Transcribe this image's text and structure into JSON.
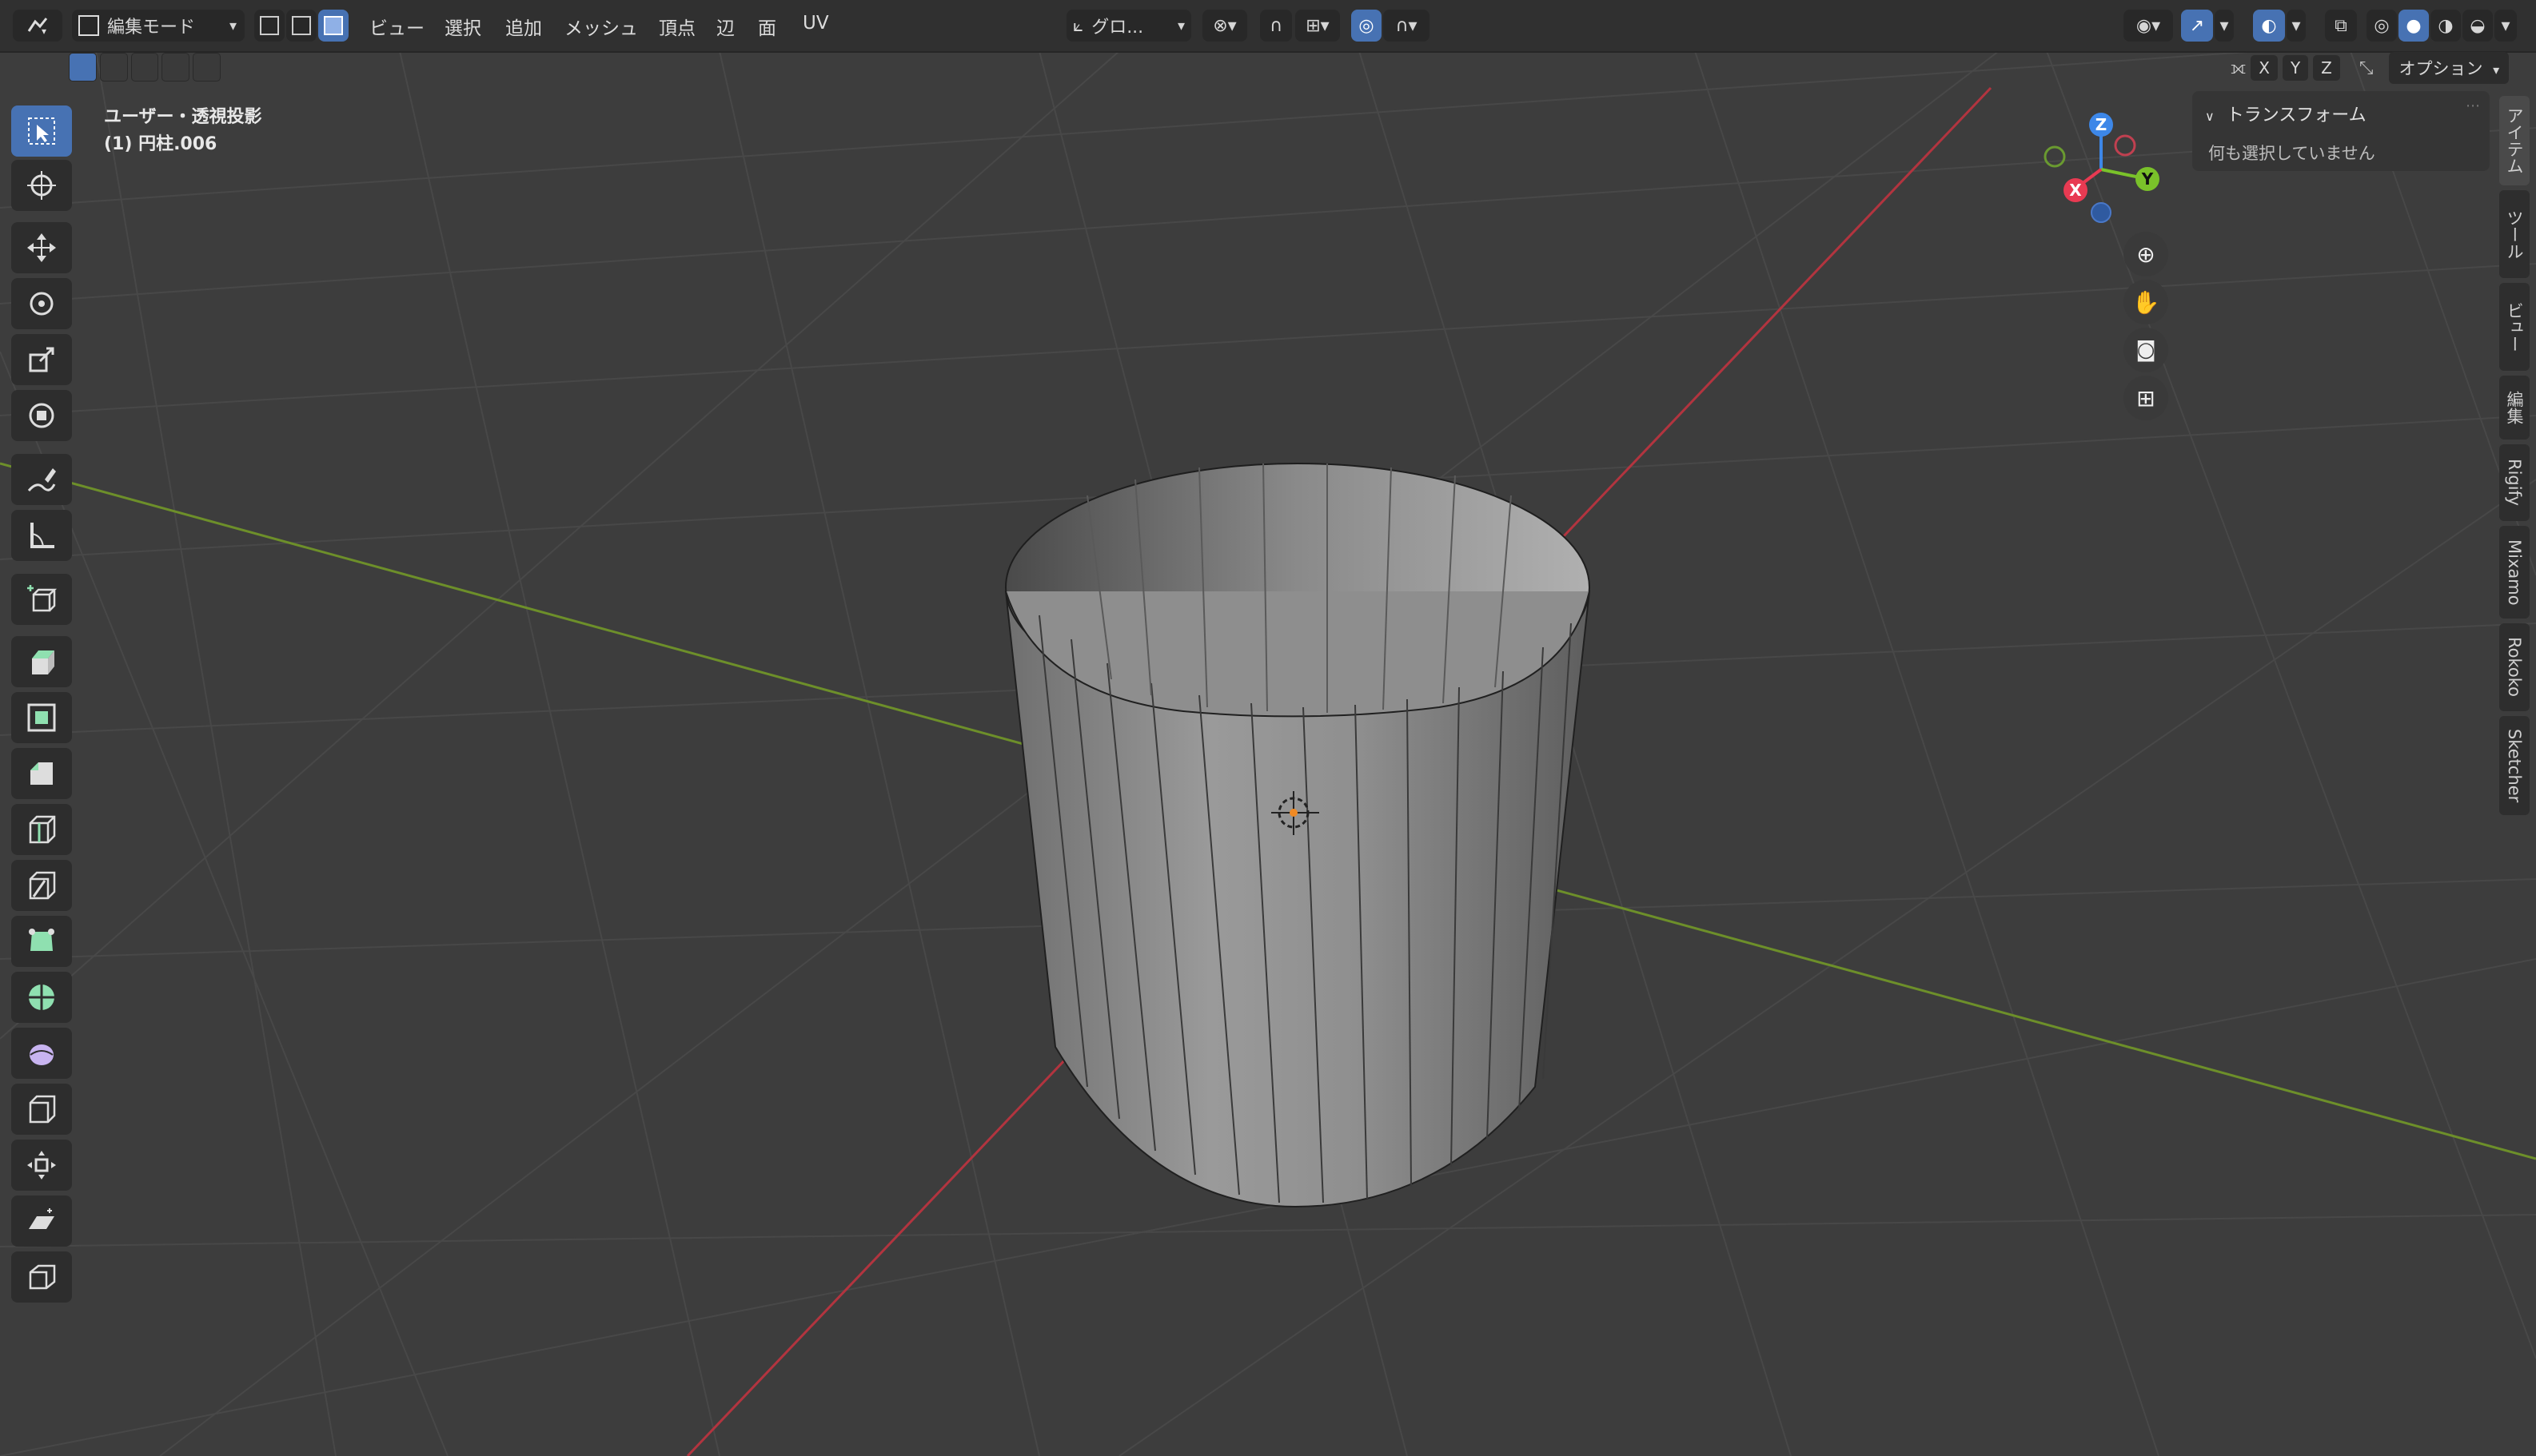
{
  "header": {
    "mode_label": "編集モード",
    "menus": [
      "ビュー",
      "選択",
      "追加",
      "メッシュ",
      "頂点",
      "辺",
      "面",
      "UV"
    ],
    "orientation_label": "グロ...",
    "axis_buttons": [
      "X",
      "Y",
      "Z"
    ],
    "options_label": "オプション"
  },
  "viewport": {
    "view_name": "ユーザー・透視投影",
    "object_name": "(1) 円柱.006"
  },
  "gizmo": {
    "z": "Z",
    "y": "Y",
    "x": "X"
  },
  "npanel": {
    "section_title": "トランスフォーム",
    "empty_message": "何も選択していません",
    "tabs": [
      "アイテム",
      "ツール",
      "ビュー",
      "編集",
      "Rigify",
      "Mixamo",
      "Rokoko",
      "Sketcher"
    ]
  },
  "tools": [
    "select-box-icon",
    "cursor-icon",
    "move-icon",
    "rotate-icon",
    "scale-icon",
    "transform-icon",
    "annotate-icon",
    "measure-icon",
    "add-cube-icon",
    "extrude-icon",
    "inset-icon",
    "bevel-icon",
    "loop-cut-icon",
    "knife-icon",
    "poly-build-icon",
    "spin-icon",
    "smooth-icon",
    "edge-slide-icon",
    "shrink-fatten-icon",
    "shear-icon",
    "rip-region-icon"
  ],
  "colors": {
    "accent": "#4772b3",
    "x_axis": "#e83a52",
    "y_axis": "#7ac22a",
    "z_axis": "#3d87e8",
    "mesh_face": "#8f8f8f"
  }
}
